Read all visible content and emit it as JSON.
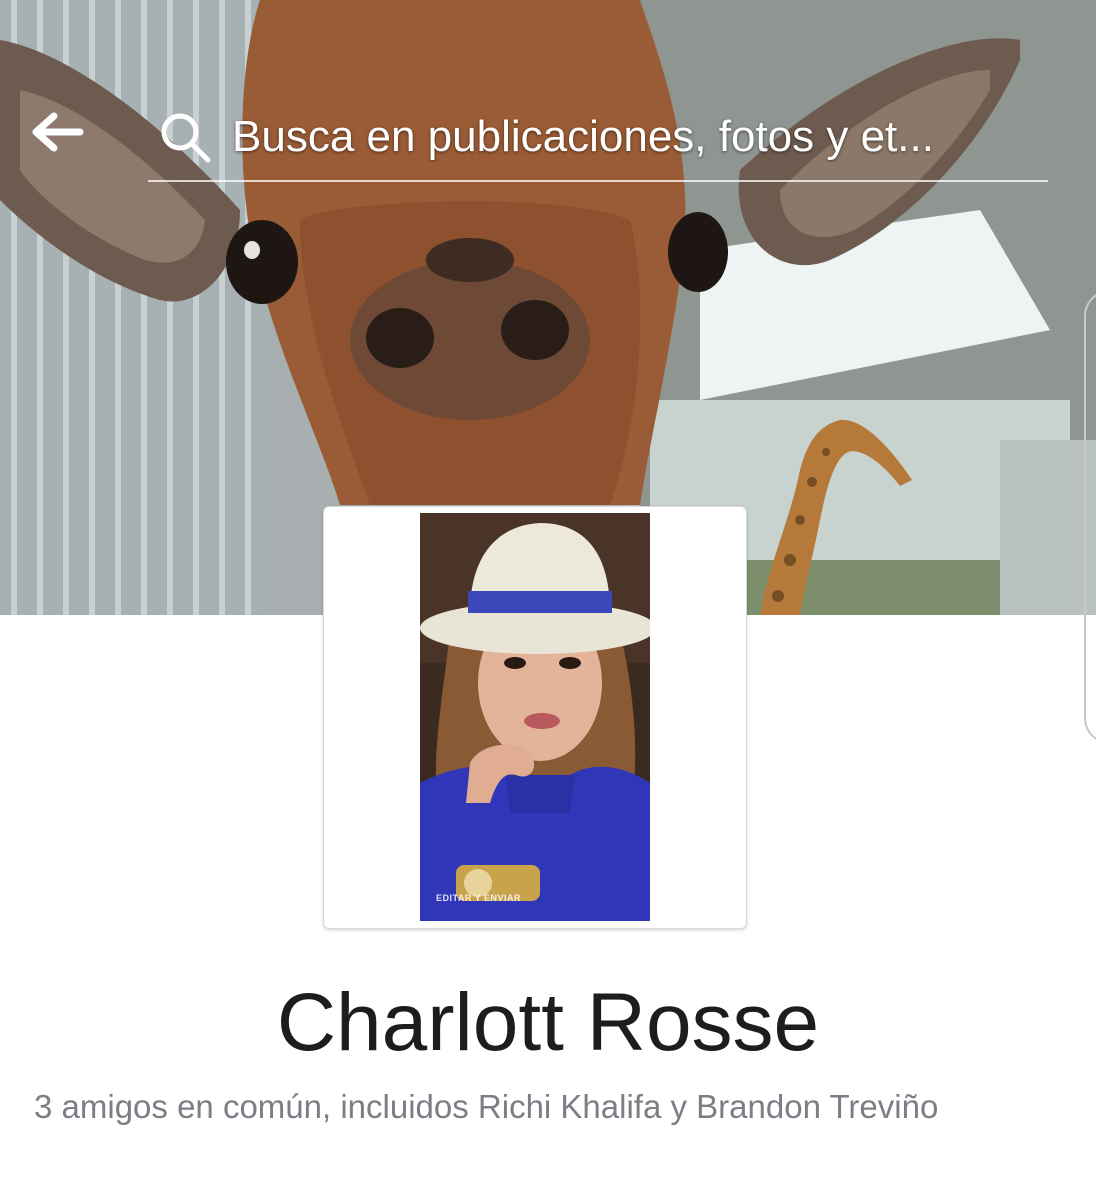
{
  "header": {
    "search": {
      "placeholder": "Busca en publicaciones, fotos y et..."
    }
  },
  "icons": {
    "back": "arrow-left-icon",
    "search": "magnifier-icon"
  },
  "profile": {
    "name": "Charlott Rosse",
    "mutual_friends": "3 amigos en común, incluidos Richi Khalifa y Brandon Treviño"
  },
  "colors": {
    "name": "#1d1d1d",
    "meta": "#7b7f85",
    "card_border": "#d9d9d9"
  }
}
